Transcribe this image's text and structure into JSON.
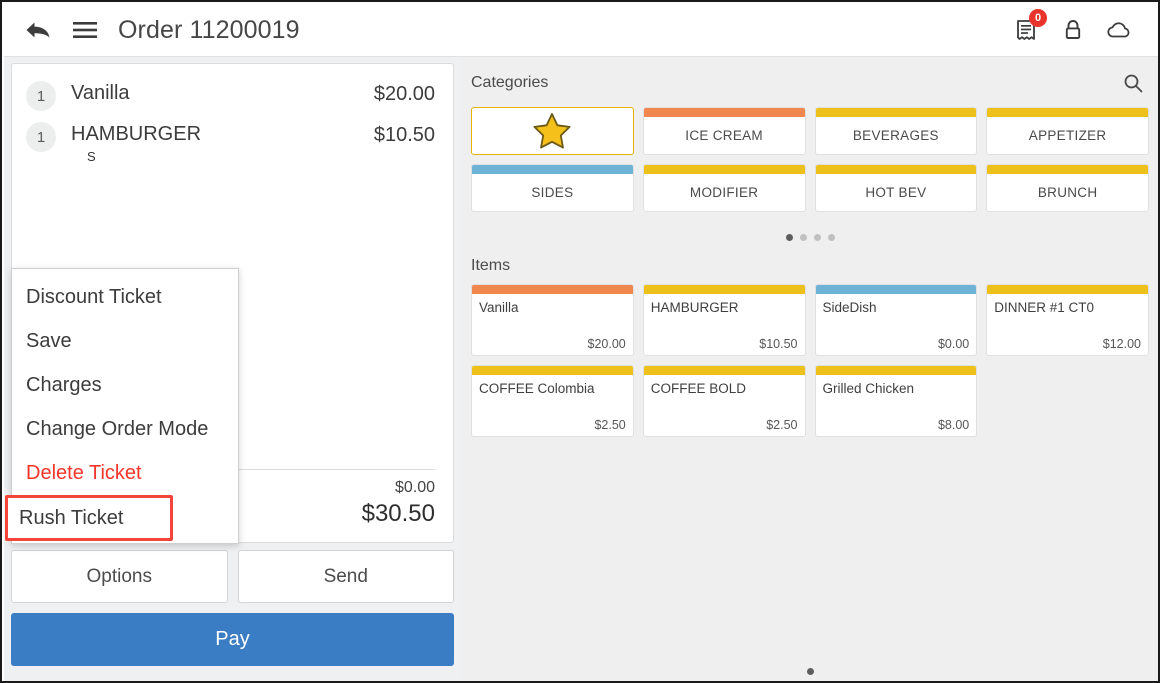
{
  "header": {
    "title": "Order 11200019",
    "back_icon": "back-arrow-icon",
    "menu_icon": "hamburger-menu-icon",
    "receipt_icon": "receipt-icon",
    "receipt_badge": "0",
    "lock_icon": "lock-icon",
    "cloud_icon": "cloud-icon"
  },
  "ticket": {
    "items": [
      {
        "qty": "1",
        "name": "Vanilla",
        "modifier": "",
        "price": "$20.00"
      },
      {
        "qty": "1",
        "name": "HAMBURGER",
        "modifier": "S",
        "price": "$10.50"
      }
    ],
    "totals": {
      "tax_label": "",
      "tax_value": "$0.00",
      "total_label": "",
      "total_value": "$30.50"
    },
    "options_label": "Options",
    "send_label": "Send",
    "pay_label": "Pay"
  },
  "context_menu": {
    "items": [
      {
        "label": "Discount Ticket",
        "style": "normal"
      },
      {
        "label": "Save",
        "style": "normal"
      },
      {
        "label": "Charges",
        "style": "normal"
      },
      {
        "label": "Change Order Mode",
        "style": "normal"
      },
      {
        "label": "Delete Ticket",
        "style": "danger"
      },
      {
        "label": "Rush Ticket",
        "style": "highlighted"
      }
    ],
    "highlight_color": "#f4453a"
  },
  "catalog": {
    "categories_title": "Categories",
    "search_icon": "search-icon",
    "star_icon": "star-icon",
    "categories": [
      {
        "label": "",
        "bar": "#f5c01a",
        "favorite": true
      },
      {
        "label": "ICE CREAM",
        "bar": "#f0874c",
        "favorite": false
      },
      {
        "label": "BEVERAGES",
        "bar": "#edc01c",
        "favorite": false
      },
      {
        "label": "APPETIZER",
        "bar": "#edc01c",
        "favorite": false
      },
      {
        "label": "SIDES",
        "bar": "#6fb3d6",
        "favorite": false
      },
      {
        "label": "MODIFIER",
        "bar": "#edc01c",
        "favorite": false
      },
      {
        "label": "HOT BEV",
        "bar": "#edc01c",
        "favorite": false
      },
      {
        "label": "BRUNCH",
        "bar": "#edc01c",
        "favorite": false
      }
    ],
    "categories_pager": {
      "count": 4,
      "active": 0
    },
    "items_title": "Items",
    "items": [
      {
        "name": "Vanilla",
        "price": "$20.00",
        "bar": "#f0874c"
      },
      {
        "name": "HAMBURGER",
        "price": "$10.50",
        "bar": "#edc01c"
      },
      {
        "name": "SideDish",
        "price": "$0.00",
        "bar": "#6fb3d6"
      },
      {
        "name": "DINNER #1 CT0",
        "price": "$12.00",
        "bar": "#edc01c"
      },
      {
        "name": "COFFEE Colombia",
        "price": "$2.50",
        "bar": "#edc01c"
      },
      {
        "name": "COFFEE BOLD",
        "price": "$2.50",
        "bar": "#edc01c"
      },
      {
        "name": "Grilled Chicken",
        "price": "$8.00",
        "bar": "#edc01c"
      }
    ],
    "items_pager": {
      "count": 1,
      "active": 0
    }
  }
}
